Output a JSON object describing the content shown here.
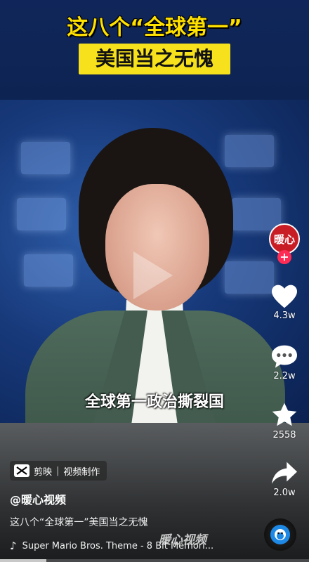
{
  "banner": {
    "line1": "这八个“全球第一”",
    "line2": "美国当之无愧"
  },
  "video": {
    "subtitle": "全球第一政治撕裂国"
  },
  "sidebar": {
    "avatar_text": "暖心",
    "follow": "+",
    "likes": "4.3w",
    "comments": "2.2w",
    "favorites": "2558",
    "shares": "2.0w"
  },
  "capcut": {
    "app": "剪映",
    "label": "视频制作"
  },
  "post": {
    "author": "@暖心视频",
    "description": "这八个“全球第一”美国当之无愧",
    "music": "Super Mario Bros. Theme - 8 Bit Memori...",
    "watermark": "暖心视频"
  },
  "playback": {
    "progress": 0.15
  },
  "colors": {
    "title_yellow": "#ffe100",
    "title_box": "#f6e11c",
    "follow_red": "#fe2c55",
    "avatar_red": "#c81d25"
  }
}
